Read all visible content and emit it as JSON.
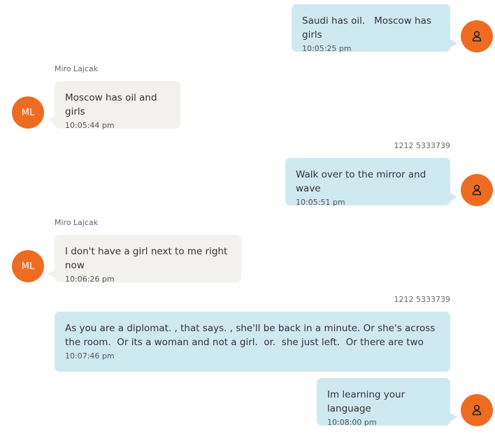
{
  "colors": {
    "outgoing_bubble": "#cfe9f1",
    "incoming_bubble": "#f3f1ee",
    "avatar": "#ee6c22"
  },
  "messages": [
    {
      "direction": "outgoing",
      "text": "Saudi has oil.   Moscow has girls",
      "time": "10:05:25 pm",
      "avatar_icon": "user-icon"
    },
    {
      "direction": "incoming",
      "sender": "Miro Lajcak",
      "text": "Moscow has oil and girls",
      "time": "10:05:44 pm",
      "avatar_initials": "ML"
    },
    {
      "direction": "outgoing",
      "sender": "1212 5333739",
      "text": "Walk over to the mirror and wave",
      "time": "10:05:51 pm",
      "avatar_icon": "user-icon"
    },
    {
      "direction": "incoming",
      "sender": "Miro Lajcak",
      "text": "I don't have a girl next to me right now",
      "time": "10:06:26 pm",
      "avatar_initials": "ML"
    },
    {
      "direction": "outgoing",
      "sender": "1212 5333739",
      "text": "As you are a diplomat. , that says. , she'll be back in a minute. Or she's across the room.  Or its a woman and not a girl.  or.  she just left.  Or there are two",
      "time": "10:07:46 pm"
    },
    {
      "direction": "outgoing",
      "text": "Im learning your language",
      "time": "10:08:00 pm",
      "avatar_icon": "user-icon"
    }
  ]
}
